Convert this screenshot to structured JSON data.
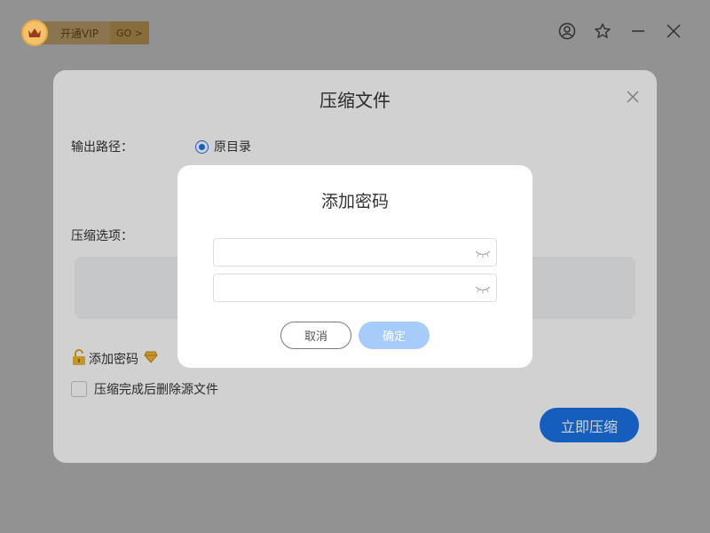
{
  "titlebar": {
    "vip_label": "开通VIP",
    "vip_go": "GO >",
    "icons": [
      "user-icon",
      "star-icon",
      "minimize-icon",
      "close-icon"
    ]
  },
  "compress_dialog": {
    "title": "压缩文件",
    "output_path_label": "输出路径：",
    "output_option": "原目录",
    "options_label": "压缩选项：",
    "add_password_label": "添加密码",
    "delete_source_label": "压缩完成后删除源文件",
    "compress_button": "立即压缩"
  },
  "password_dialog": {
    "title": "添加密码",
    "password_value": "",
    "confirm_value": "",
    "cancel_label": "取消",
    "ok_label": "确定"
  },
  "colors": {
    "accent": "#1a73e8",
    "accent_disabled": "#a6ccfb",
    "vip_gold": "#f3cf8a"
  }
}
